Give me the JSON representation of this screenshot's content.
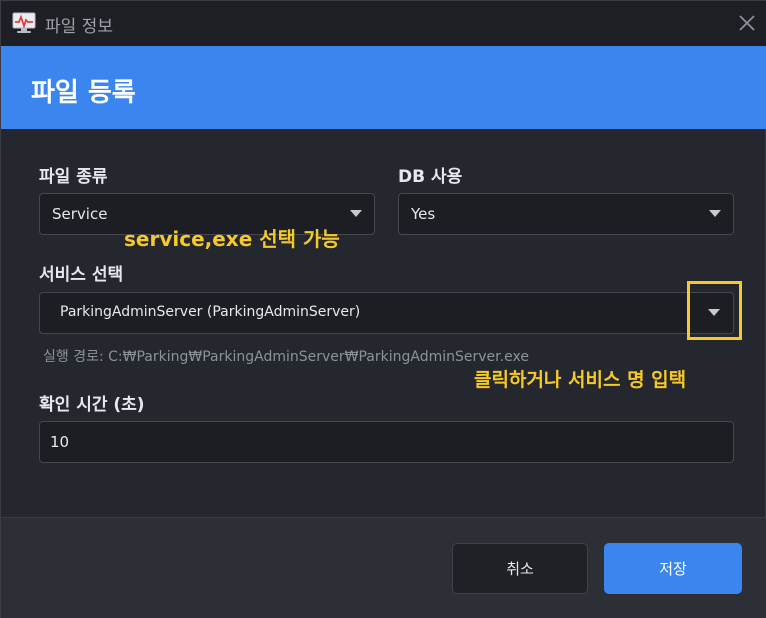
{
  "window": {
    "title": "파일 정보"
  },
  "header": {
    "title": "파일 등록"
  },
  "fields": {
    "file_type": {
      "label": "파일 종류",
      "value": "Service"
    },
    "db_use": {
      "label": "DB 사용",
      "value": "Yes"
    },
    "service_select": {
      "label": "서비스 선택",
      "value": "ParkingAdminServer (ParkingAdminServer)",
      "path": "실행 경로: C:₩Parking₩ParkingAdminServer₩ParkingAdminServer.exe"
    },
    "check_time": {
      "label": "확인 시간 (초)",
      "value": "10"
    }
  },
  "annotations": {
    "select_hint": "service,exe 선택 가능",
    "input_hint": "클릭하거나 서비스 명 입택"
  },
  "footer": {
    "cancel_label": "취소",
    "save_label": "저장"
  },
  "colors": {
    "accent": "#3b86ee",
    "annotation": "#f5c92a",
    "background": "#25272f"
  }
}
